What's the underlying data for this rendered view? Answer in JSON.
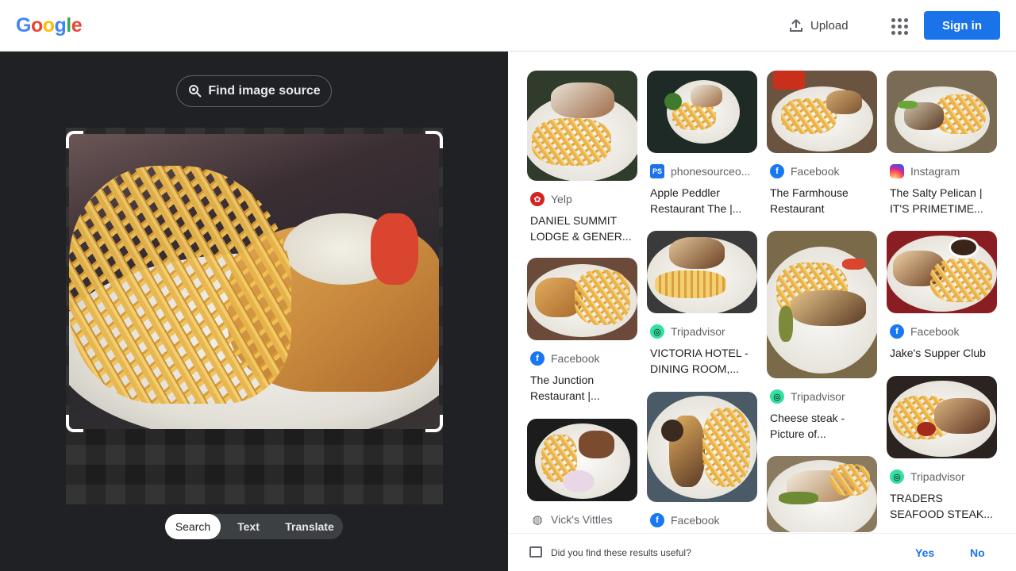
{
  "header": {
    "logo_letters": [
      {
        "ch": "G",
        "color": "#4285f4"
      },
      {
        "ch": "o",
        "color": "#ea4335"
      },
      {
        "ch": "o",
        "color": "#fbbc05"
      },
      {
        "ch": "g",
        "color": "#4285f4"
      },
      {
        "ch": "l",
        "color": "#34a853"
      },
      {
        "ch": "e",
        "color": "#ea4335"
      }
    ],
    "upload_label": "Upload",
    "upload_icon": "upload-icon",
    "apps_icon": "apps-grid-icon",
    "signin_label": "Sign in",
    "accent": "#1a73e8"
  },
  "lens": {
    "find_source_label": "Find image source",
    "find_source_icon": "lens-search-icon",
    "modes": [
      {
        "label": "Search",
        "active": true
      },
      {
        "label": "Text",
        "active": false
      },
      {
        "label": "Translate",
        "active": false
      }
    ]
  },
  "results": [
    {
      "source": "Yelp",
      "source_color": "#d32323",
      "source_glyph": "✿",
      "title": "DANIEL SUMMIT LODGE & GENER..."
    },
    {
      "source": "Facebook",
      "source_color": "#1877f2",
      "source_glyph": "f",
      "title": "The Junction Restaurant |..."
    },
    {
      "source": "Vick's Vittles",
      "source_color": "#5f6368",
      "source_glyph": "◍",
      "title": ""
    },
    {
      "source": "phonesourceo...",
      "source_color": "#1a73e8",
      "source_glyph": "PS",
      "title": "Apple Peddler Restaurant The |..."
    },
    {
      "source": "Tripadvisor",
      "source_color": "#34e0a1",
      "source_glyph": "◎",
      "title": "VICTORIA HOTEL - DINING ROOM,..."
    },
    {
      "source": "Facebook",
      "source_color": "#1877f2",
      "source_glyph": "f",
      "title": ""
    },
    {
      "source": "Facebook",
      "source_color": "#1877f2",
      "source_glyph": "f",
      "title": "The Farmhouse Restaurant"
    },
    {
      "source": "Tripadvisor",
      "source_color": "#34e0a1",
      "source_glyph": "◎",
      "title": "Cheese steak - Picture of..."
    },
    {
      "source": "Instagram",
      "source_color": "#d62976",
      "source_glyph": "◘",
      "title": "The Salty Pelican | IT'S PRIMETIME..."
    },
    {
      "source": "Facebook",
      "source_color": "#1877f2",
      "source_glyph": "f",
      "title": "Jake's Supper Club"
    },
    {
      "source": "Tripadvisor",
      "source_color": "#34e0a1",
      "source_glyph": "◎",
      "title": "TRADERS SEAFOOD STEAK..."
    }
  ],
  "feedback": {
    "question": "Did you find these results useful?",
    "yes": "Yes",
    "no": "No"
  }
}
